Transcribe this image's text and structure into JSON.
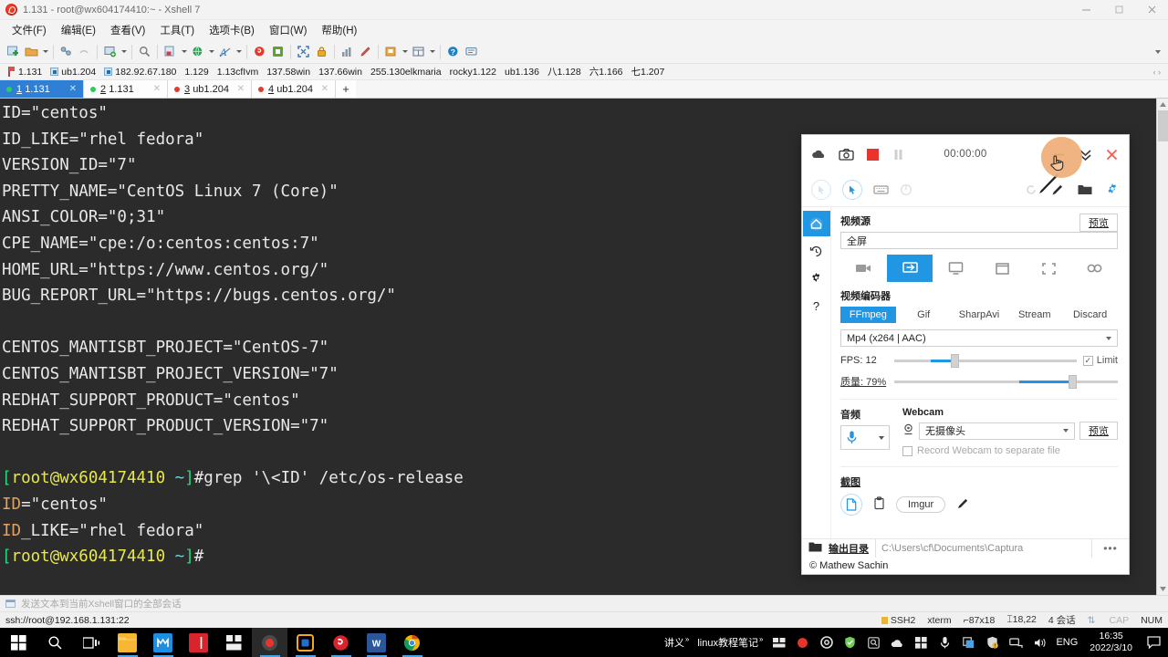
{
  "window": {
    "title": "1.131 - root@wx604174410:~ - Xshell 7",
    "app_icon": "xshell-logo-icon",
    "minimize": "–",
    "maximize": "□",
    "close": "✕"
  },
  "menubar": [
    {
      "label": "文件(F)",
      "name": "menu-file"
    },
    {
      "label": "编辑(E)",
      "name": "menu-edit"
    },
    {
      "label": "查看(V)",
      "name": "menu-view"
    },
    {
      "label": "工具(T)",
      "name": "menu-tools"
    },
    {
      "label": "选项卡(B)",
      "name": "menu-tab"
    },
    {
      "label": "窗口(W)",
      "name": "menu-window"
    },
    {
      "label": "帮助(H)",
      "name": "menu-help"
    }
  ],
  "toolbar": {
    "icons": [
      "new-session-icon",
      "open-folder-icon",
      "folder-dropdown-caret",
      "connect-icon",
      "disconnect-icon",
      "session-manager-icon",
      "session-dropdown-caret",
      "find-icon",
      "file-transfer-icon",
      "file-transfer-caret",
      "globe-icon",
      "globe-caret",
      "font-icon",
      "font-caret",
      "xshell-icon",
      "xftp-icon",
      "fullscreen-icon",
      "lock-icon",
      "chart-icon",
      "highlight-icon",
      "compose-icon",
      "compose-caret",
      "layout-icon",
      "layout-caret",
      "help-icon",
      "feedback-icon"
    ]
  },
  "hostbar": {
    "items": [
      {
        "label": "1.131",
        "icon": "bookmark-flag-icon"
      },
      {
        "label": "ub1.204",
        "icon": "session-icon"
      },
      {
        "label": "182.92.67.180",
        "icon": "session-icon"
      },
      {
        "label": "1.129",
        "icon": ""
      },
      {
        "label": "1.13cfIvm",
        "icon": ""
      },
      {
        "label": "137.58win",
        "icon": ""
      },
      {
        "label": "137.66win",
        "icon": ""
      },
      {
        "label": "255.130elkmaria",
        "icon": ""
      },
      {
        "label": "rocky1.122",
        "icon": ""
      },
      {
        "label": "ub1.136",
        "icon": ""
      },
      {
        "label": "八1.128",
        "icon": ""
      },
      {
        "label": "六1.166",
        "icon": ""
      },
      {
        "label": "七1.207",
        "icon": ""
      }
    ]
  },
  "tabs": [
    {
      "num": "1",
      "label": "1.131",
      "dot": "#2ecc5a",
      "active": true
    },
    {
      "num": "2",
      "label": "1.131",
      "dot": "#2ecc5a",
      "active": false
    },
    {
      "num": "3",
      "label": "ub1.204",
      "dot": "#e23c2e",
      "active": false
    },
    {
      "num": "4",
      "label": "ub1.204",
      "dot": "#e23c2e",
      "active": false
    }
  ],
  "tab_add_label": "+",
  "terminal": {
    "lines": [
      [
        {
          "t": "ID=\"centos\"",
          "c": "white"
        }
      ],
      [
        {
          "t": "ID_LIKE=\"rhel fedora\"",
          "c": "white"
        }
      ],
      [
        {
          "t": "VERSION_ID=\"7\"",
          "c": "white"
        }
      ],
      [
        {
          "t": "PRETTY_NAME=\"CentOS Linux 7 (Core)\"",
          "c": "white"
        }
      ],
      [
        {
          "t": "ANSI_COLOR=\"0;31\"",
          "c": "white"
        }
      ],
      [
        {
          "t": "CPE_NAME=\"cpe:/o:centos:centos:7\"",
          "c": "white"
        }
      ],
      [
        {
          "t": "HOME_URL=\"https://www.centos.org/\"",
          "c": "white"
        }
      ],
      [
        {
          "t": "BUG_REPORT_URL=\"https://bugs.centos.org/\"",
          "c": "white"
        }
      ],
      [
        {
          "t": "",
          "c": "white"
        }
      ],
      [
        {
          "t": "CENTOS_MANTISBT_PROJECT=\"CentOS-7\"",
          "c": "white"
        }
      ],
      [
        {
          "t": "CENTOS_MANTISBT_PROJECT_VERSION=\"7\"",
          "c": "white"
        }
      ],
      [
        {
          "t": "REDHAT_SUPPORT_PRODUCT=\"centos\"",
          "c": "white"
        }
      ],
      [
        {
          "t": "REDHAT_SUPPORT_PRODUCT_VERSION=\"7\"",
          "c": "white"
        }
      ],
      [
        {
          "t": "",
          "c": "white"
        }
      ],
      [
        {
          "t": "[",
          "c": "green"
        },
        {
          "t": "root@wx604174410",
          "c": "yellow"
        },
        {
          "t": " ~",
          "c": "cyan"
        },
        {
          "t": "]",
          "c": "green"
        },
        {
          "t": "#grep '\\<ID' /etc/os-release",
          "c": "white"
        }
      ],
      [
        {
          "t": "ID",
          "c": "orange"
        },
        {
          "t": "=\"centos\"",
          "c": "white"
        }
      ],
      [
        {
          "t": "ID",
          "c": "orange"
        },
        {
          "t": "_LIKE=\"rhel fedora\"",
          "c": "white"
        }
      ],
      [
        {
          "t": "[",
          "c": "green"
        },
        {
          "t": "root@wx604174410",
          "c": "yellow"
        },
        {
          "t": " ~",
          "c": "cyan"
        },
        {
          "t": "]",
          "c": "green"
        },
        {
          "t": "#",
          "c": "white"
        }
      ]
    ]
  },
  "sendbar": {
    "hint": "发送文本到当前Xshell窗口的全部会话",
    "icon": "send-to-all-icon"
  },
  "statusbar": {
    "connection": "ssh://root@192.168.1.131:22",
    "protocol": "SSH2",
    "term_type": "xterm",
    "size": "87x18",
    "cursor": "18,22",
    "sessions": "4 会话",
    "cap": "CAP",
    "num": "NUM"
  },
  "captura": {
    "timer": "00:00:00",
    "top_icons": [
      "cloud-upload-icon",
      "camera-icon",
      "stop-record-icon",
      "pause-icon"
    ],
    "top_right_icons": [
      "minimize-icon",
      "chevron-double-down-icon",
      "close-icon"
    ],
    "row2_icons": [
      "cursor-click-left-icon",
      "cursor-click-right-icon",
      "keyboard-icon",
      "clicks-icon"
    ],
    "row2_right_icons": [
      "refresh-icon",
      "pen-icon",
      "folder-icon",
      "gear-icon"
    ],
    "sidebar": [
      {
        "icon": "home-icon",
        "name": "sidebar-home",
        "active": true
      },
      {
        "icon": "history-icon",
        "name": "sidebar-history",
        "active": false
      },
      {
        "icon": "gear-icon",
        "name": "sidebar-settings",
        "active": false
      },
      {
        "icon": "help-icon",
        "name": "sidebar-help",
        "active": false
      }
    ],
    "video_source": {
      "title": "视频源",
      "preview_btn": "预览",
      "value": "全屏",
      "source_icons": [
        {
          "icon": "webcam-source-icon",
          "active": false
        },
        {
          "icon": "fullscreen-source-icon",
          "active": true
        },
        {
          "icon": "screen-source-icon",
          "active": false
        },
        {
          "icon": "window-source-icon",
          "active": false
        },
        {
          "icon": "region-source-icon",
          "active": false
        },
        {
          "icon": "nocapture-source-icon",
          "active": false
        }
      ]
    },
    "video_encoder": {
      "title": "视频编码器",
      "tabs": [
        {
          "label": "FFmpeg",
          "active": true
        },
        {
          "label": "Gif",
          "active": false
        },
        {
          "label": "SharpAvi",
          "active": false
        },
        {
          "label": "Stream",
          "active": false
        },
        {
          "label": "Discard",
          "active": false
        }
      ],
      "codec": "Mp4 (x264 | AAC)",
      "fps_label": "FPS: 12",
      "fps_percent": 30,
      "limit_label": "Limit",
      "limit_checked": "✓",
      "quality_label": "质量: 79%",
      "quality_percent": 79
    },
    "audio": {
      "title": "音频",
      "icon": "microphone-icon"
    },
    "webcam": {
      "title": "Webcam",
      "icon": "webcam-icon",
      "value": "无摄像头",
      "preview_btn": "预览",
      "separate_file_label": "Record Webcam to separate file"
    },
    "screenshot": {
      "title": "截图",
      "icons": [
        "save-file-icon",
        "clipboard-icon",
        "pencil-icon"
      ],
      "imgur_label": "Imgur"
    },
    "output": {
      "icon": "folder-icon",
      "label": "输出目录",
      "path": "C:\\Users\\cf\\Documents\\Captura",
      "more": "•••"
    },
    "copyright": "© Mathew Sachin"
  },
  "taskbar": {
    "buttons": [
      {
        "name": "start-button",
        "icon": "windows-logo-icon"
      },
      {
        "name": "search-button",
        "icon": "search-icon"
      },
      {
        "name": "task-view-button",
        "icon": "task-view-icon"
      },
      {
        "name": "file-explorer-button",
        "icon": "file-explorer-icon",
        "color": "#f5b945"
      },
      {
        "name": "maxthon-button",
        "icon": "maxthon-icon",
        "color": "#1e8fe0"
      },
      {
        "name": "pdf-button",
        "icon": "pdf-reader-icon",
        "color": "#d9232d"
      },
      {
        "name": "qr-button",
        "icon": "qr-tool-icon",
        "color": "#e8e8e8"
      },
      {
        "name": "captura-button",
        "icon": "captura-icon",
        "color": "#333333"
      },
      {
        "name": "vmware-button",
        "icon": "vmware-icon",
        "color": "#f5a623"
      },
      {
        "name": "xshell-button",
        "icon": "xshell-icon",
        "color": "#d9232d"
      },
      {
        "name": "word-button",
        "icon": "word-icon",
        "color": "#2b579a"
      },
      {
        "name": "chrome-button",
        "icon": "chrome-icon",
        "color": "#4285f4"
      }
    ],
    "tray_groups": [
      {
        "label": "讲义",
        "sup": "»"
      },
      {
        "label": "linux教程笔记",
        "sup": "»"
      }
    ],
    "tray_icons": [
      "screen-layout-icon",
      "record-dot-icon",
      "settings-gear-icon",
      "shield-icon",
      "search-tray-icon",
      "cloud-tray-icon",
      "windows-tray-icon",
      "microphone-tray-icon",
      "copy-tray-icon",
      "security-warning-icon",
      "network-icon",
      "volume-icon"
    ],
    "language": "ENG",
    "time": "16:35",
    "date": "2022/3/10",
    "notification_icon": "notification-icon"
  }
}
